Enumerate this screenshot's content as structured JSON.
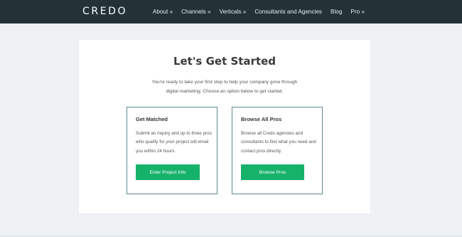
{
  "header": {
    "logo": "CREDO",
    "nav": [
      {
        "label": "About »"
      },
      {
        "label": "Channels »"
      },
      {
        "label": "Verticals »"
      },
      {
        "label": "Consultants and Agencies"
      },
      {
        "label": "Blog"
      },
      {
        "label": "Pro »"
      }
    ]
  },
  "main": {
    "title": "Let's Get Started",
    "subtitle": "You're ready to take your first step to help your company grow through digital marketing. Choose an option below to get started.",
    "options": [
      {
        "title": "Get Matched",
        "description": "Submit an inquiry and up to three pros who qualify for your project will email you within 24 hours.",
        "button": "Enter Project Info"
      },
      {
        "title": "Browse All Pros",
        "description": "Browse all Credo agencies and consultants to find what you need and contact pros directly.",
        "button": "Browse Pros"
      }
    ]
  },
  "colors": {
    "navbar": "#233237",
    "accent": "#17b26a",
    "option_border": "#5e8896",
    "background": "#eef2f5"
  }
}
